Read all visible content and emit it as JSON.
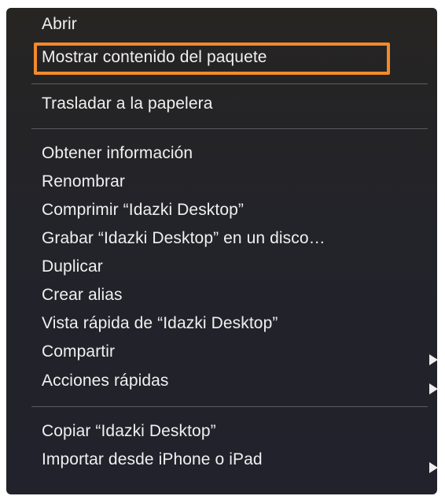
{
  "menu": {
    "groups": [
      {
        "items": [
          {
            "label": "Abrir"
          },
          {
            "label": "Mostrar contenido del paquete"
          }
        ]
      },
      {
        "items": [
          {
            "label": "Trasladar a la papelera"
          }
        ]
      },
      {
        "items": [
          {
            "label": "Obtener información"
          },
          {
            "label": "Renombrar"
          },
          {
            "label": "Comprimir “Idazki Desktop”"
          },
          {
            "label": "Grabar “Idazki Desktop” en un disco…"
          },
          {
            "label": "Duplicar"
          },
          {
            "label": "Crear alias"
          },
          {
            "label": "Vista rápida de “Idazki Desktop”"
          },
          {
            "label": "Compartir",
            "submenu": true
          },
          {
            "label": "Acciones rápidas",
            "submenu": true
          }
        ]
      },
      {
        "items": [
          {
            "label": "Copiar “Idazki Desktop”"
          },
          {
            "label": "Importar desde iPhone o iPad",
            "submenu": true
          }
        ]
      }
    ],
    "highlighted_item": "Mostrar contenido del paquete",
    "colors": {
      "background": "#242428",
      "text": "#f0f0f0",
      "separator": "#5c5c60",
      "highlight_outline": "#f28a2b"
    },
    "icons": {
      "submenu_indicator": "chevron-right-icon"
    }
  }
}
